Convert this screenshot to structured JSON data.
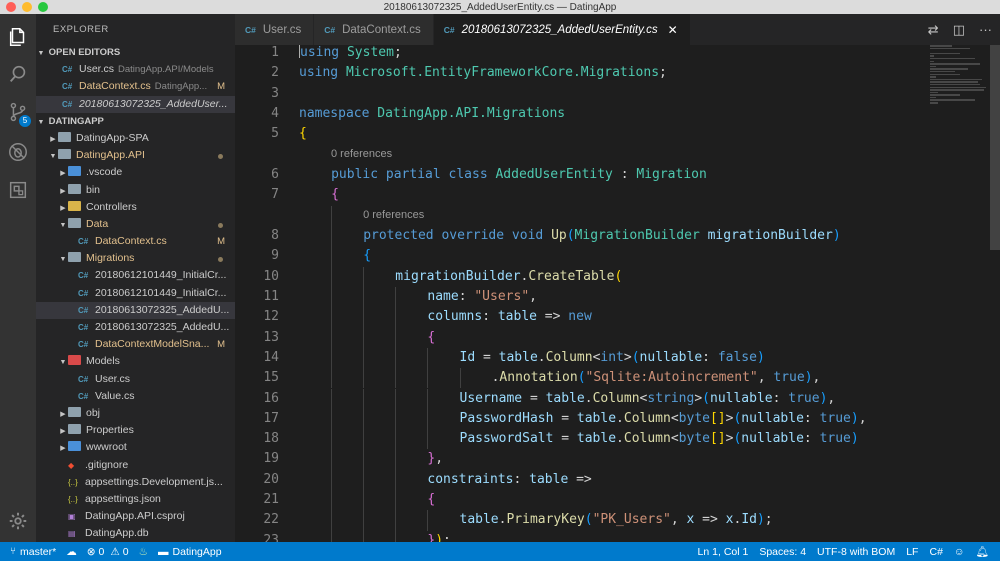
{
  "window": {
    "title": "20180613072325_AddedUserEntity.cs — DatingApp",
    "traffic_lights": [
      "#ff5f57",
      "#febc2e",
      "#28c840"
    ]
  },
  "activity_bar": {
    "items": [
      {
        "icon": "files-icon"
      },
      {
        "icon": "search-icon"
      },
      {
        "icon": "source-control-icon",
        "badge": "5"
      },
      {
        "icon": "debug-icon"
      },
      {
        "icon": "extensions-icon"
      }
    ],
    "settings_icon": "gear-icon"
  },
  "explorer": {
    "title": "EXPLORER",
    "open_editors": {
      "label": "OPEN EDITORS",
      "items": [
        {
          "name": "User.cs",
          "hint": "DatingApp.API/Models",
          "mark": ""
        },
        {
          "name": "DataContext.cs",
          "hint": "DatingApp...",
          "mark": "M"
        },
        {
          "name": "20180613072325_AddedUser...",
          "hint": "",
          "mark": ""
        }
      ]
    },
    "project": {
      "label": "DATINGAPP",
      "tree": [
        {
          "name": "DatingApp-SPA",
          "kind": "folder",
          "depth": 0,
          "open": false
        },
        {
          "name": "DatingApp.API",
          "kind": "folder",
          "depth": 0,
          "open": true,
          "dot": true,
          "yellow": true
        },
        {
          "name": ".vscode",
          "kind": "folder",
          "depth": 1,
          "open": false
        },
        {
          "name": "bin",
          "kind": "folder",
          "depth": 1,
          "open": false
        },
        {
          "name": "Controllers",
          "kind": "folder",
          "depth": 1,
          "open": false
        },
        {
          "name": "Data",
          "kind": "folder",
          "depth": 1,
          "open": true,
          "dot": true,
          "yellow": true
        },
        {
          "name": "DataContext.cs",
          "kind": "cs",
          "depth": 2,
          "mark": "M",
          "yellow": true
        },
        {
          "name": "Migrations",
          "kind": "folder",
          "depth": 1,
          "open": true,
          "dot": true,
          "yellow": true
        },
        {
          "name": "20180612101449_InitialCr...",
          "kind": "cs",
          "depth": 2
        },
        {
          "name": "20180612101449_InitialCr...",
          "kind": "cs",
          "depth": 2
        },
        {
          "name": "20180613072325_AddedU...",
          "kind": "cs",
          "depth": 2,
          "selected": true
        },
        {
          "name": "20180613072325_AddedU...",
          "kind": "cs",
          "depth": 2
        },
        {
          "name": "DataContextModelSna...",
          "kind": "cs",
          "depth": 2,
          "mark": "M",
          "yellow": true
        },
        {
          "name": "Models",
          "kind": "folder",
          "depth": 1,
          "open": true
        },
        {
          "name": "User.cs",
          "kind": "cs",
          "depth": 2
        },
        {
          "name": "Value.cs",
          "kind": "cs",
          "depth": 2
        },
        {
          "name": "obj",
          "kind": "folder",
          "depth": 1,
          "open": false
        },
        {
          "name": "Properties",
          "kind": "folder",
          "depth": 1,
          "open": false
        },
        {
          "name": "wwwroot",
          "kind": "folder",
          "depth": 1,
          "open": false
        },
        {
          "name": ".gitignore",
          "kind": "git",
          "depth": 1
        },
        {
          "name": "appsettings.Development.js...",
          "kind": "json",
          "depth": 1
        },
        {
          "name": "appsettings.json",
          "kind": "json",
          "depth": 1
        },
        {
          "name": "DatingApp.API.csproj",
          "kind": "proj",
          "depth": 1
        },
        {
          "name": "DatingApp.db",
          "kind": "db",
          "depth": 1
        }
      ]
    }
  },
  "tabs": [
    {
      "label": "User.cs",
      "active": false
    },
    {
      "label": "DataContext.cs",
      "active": false
    },
    {
      "label": "20180613072325_AddedUserEntity.cs",
      "active": true
    }
  ],
  "tab_icon_text": "C#",
  "editor": {
    "references_label": "0 references",
    "lines": [
      {
        "n": "1",
        "indent": 0,
        "tokens": [
          [
            "kw",
            "using"
          ],
          [
            "tx",
            " "
          ],
          [
            "ty",
            "System"
          ],
          [
            "tx",
            ";"
          ]
        ],
        "caret": true
      },
      {
        "n": "2",
        "indent": 0,
        "tokens": [
          [
            "kw",
            "using"
          ],
          [
            "tx",
            " "
          ],
          [
            "ty",
            "Microsoft.EntityFrameworkCore.Migrations"
          ],
          [
            "tx",
            ";"
          ]
        ]
      },
      {
        "n": "3",
        "indent": 0,
        "tokens": []
      },
      {
        "n": "4",
        "indent": 0,
        "tokens": [
          [
            "kw",
            "namespace"
          ],
          [
            "tx",
            " "
          ],
          [
            "ty",
            "DatingApp.API.Migrations"
          ]
        ]
      },
      {
        "n": "5",
        "indent": 0,
        "tokens": [
          [
            "b1",
            "{"
          ]
        ]
      },
      {
        "n": "6",
        "indent": 1,
        "lens": true,
        "tokens": [
          [
            "kw",
            "public"
          ],
          [
            "tx",
            " "
          ],
          [
            "kw",
            "partial"
          ],
          [
            "tx",
            " "
          ],
          [
            "kw",
            "class"
          ],
          [
            "tx",
            " "
          ],
          [
            "ty",
            "AddedUserEntity"
          ],
          [
            "tx",
            " : "
          ],
          [
            "ty",
            "Migration"
          ]
        ]
      },
      {
        "n": "7",
        "indent": 1,
        "tokens": [
          [
            "b2",
            "{"
          ]
        ]
      },
      {
        "n": "8",
        "indent": 2,
        "lens": true,
        "tokens": [
          [
            "kw",
            "protected"
          ],
          [
            "tx",
            " "
          ],
          [
            "kw",
            "override"
          ],
          [
            "tx",
            " "
          ],
          [
            "kw",
            "void"
          ],
          [
            "tx",
            " "
          ],
          [
            "fn",
            "Up"
          ],
          [
            "b3",
            "("
          ],
          [
            "ty",
            "MigrationBuilder"
          ],
          [
            "tx",
            " "
          ],
          [
            "pr",
            "migrationBuilder"
          ],
          [
            "b3",
            ")"
          ]
        ]
      },
      {
        "n": "9",
        "indent": 2,
        "tokens": [
          [
            "b3",
            "{"
          ]
        ]
      },
      {
        "n": "10",
        "indent": 3,
        "tokens": [
          [
            "pr",
            "migrationBuilder"
          ],
          [
            "tx",
            "."
          ],
          [
            "fn",
            "CreateTable"
          ],
          [
            "b1",
            "("
          ]
        ]
      },
      {
        "n": "11",
        "indent": 4,
        "tokens": [
          [
            "pr",
            "name"
          ],
          [
            "tx",
            ": "
          ],
          [
            "st",
            "\"Users\""
          ],
          [
            "tx",
            ","
          ]
        ]
      },
      {
        "n": "12",
        "indent": 4,
        "tokens": [
          [
            "pr",
            "columns"
          ],
          [
            "tx",
            ": "
          ],
          [
            "pr",
            "table"
          ],
          [
            "tx",
            " => "
          ],
          [
            "kw",
            "new"
          ]
        ]
      },
      {
        "n": "13",
        "indent": 4,
        "tokens": [
          [
            "b2",
            "{"
          ]
        ]
      },
      {
        "n": "14",
        "indent": 5,
        "tokens": [
          [
            "pr",
            "Id"
          ],
          [
            "tx",
            " = "
          ],
          [
            "pr",
            "table"
          ],
          [
            "tx",
            "."
          ],
          [
            "fn",
            "Column"
          ],
          [
            "tx",
            "<"
          ],
          [
            "kw",
            "int"
          ],
          [
            "tx",
            ">"
          ],
          [
            "b3",
            "("
          ],
          [
            "pr",
            "nullable"
          ],
          [
            "tx",
            ": "
          ],
          [
            "kw",
            "false"
          ],
          [
            "b3",
            ")"
          ]
        ]
      },
      {
        "n": "15",
        "indent": 6,
        "tokens": [
          [
            "tx",
            "."
          ],
          [
            "fn",
            "Annotation"
          ],
          [
            "b3",
            "("
          ],
          [
            "st",
            "\"Sqlite:Autoincrement\""
          ],
          [
            "tx",
            ", "
          ],
          [
            "kw",
            "true"
          ],
          [
            "b3",
            ")"
          ],
          [
            "tx",
            ","
          ]
        ]
      },
      {
        "n": "16",
        "indent": 5,
        "tokens": [
          [
            "pr",
            "Username"
          ],
          [
            "tx",
            " = "
          ],
          [
            "pr",
            "table"
          ],
          [
            "tx",
            "."
          ],
          [
            "fn",
            "Column"
          ],
          [
            "tx",
            "<"
          ],
          [
            "kw",
            "string"
          ],
          [
            "tx",
            ">"
          ],
          [
            "b3",
            "("
          ],
          [
            "pr",
            "nullable"
          ],
          [
            "tx",
            ": "
          ],
          [
            "kw",
            "true"
          ],
          [
            "b3",
            ")"
          ],
          [
            "tx",
            ","
          ]
        ]
      },
      {
        "n": "17",
        "indent": 5,
        "tokens": [
          [
            "pr",
            "PasswordHash"
          ],
          [
            "tx",
            " = "
          ],
          [
            "pr",
            "table"
          ],
          [
            "tx",
            "."
          ],
          [
            "fn",
            "Column"
          ],
          [
            "tx",
            "<"
          ],
          [
            "kw",
            "byte"
          ],
          [
            "b1",
            "[]"
          ],
          [
            "tx",
            ">"
          ],
          [
            "b3",
            "("
          ],
          [
            "pr",
            "nullable"
          ],
          [
            "tx",
            ": "
          ],
          [
            "kw",
            "true"
          ],
          [
            "b3",
            ")"
          ],
          [
            "tx",
            ","
          ]
        ]
      },
      {
        "n": "18",
        "indent": 5,
        "tokens": [
          [
            "pr",
            "PasswordSalt"
          ],
          [
            "tx",
            " = "
          ],
          [
            "pr",
            "table"
          ],
          [
            "tx",
            "."
          ],
          [
            "fn",
            "Column"
          ],
          [
            "tx",
            "<"
          ],
          [
            "kw",
            "byte"
          ],
          [
            "b1",
            "[]"
          ],
          [
            "tx",
            ">"
          ],
          [
            "b3",
            "("
          ],
          [
            "pr",
            "nullable"
          ],
          [
            "tx",
            ": "
          ],
          [
            "kw",
            "true"
          ],
          [
            "b3",
            ")"
          ]
        ]
      },
      {
        "n": "19",
        "indent": 4,
        "tokens": [
          [
            "b2",
            "}"
          ],
          [
            "tx",
            ","
          ]
        ]
      },
      {
        "n": "20",
        "indent": 4,
        "tokens": [
          [
            "pr",
            "constraints"
          ],
          [
            "tx",
            ": "
          ],
          [
            "pr",
            "table"
          ],
          [
            "tx",
            " =>"
          ]
        ]
      },
      {
        "n": "21",
        "indent": 4,
        "tokens": [
          [
            "b2",
            "{"
          ]
        ]
      },
      {
        "n": "22",
        "indent": 5,
        "tokens": [
          [
            "pr",
            "table"
          ],
          [
            "tx",
            "."
          ],
          [
            "fn",
            "PrimaryKey"
          ],
          [
            "b3",
            "("
          ],
          [
            "st",
            "\"PK_Users\""
          ],
          [
            "tx",
            ", "
          ],
          [
            "pr",
            "x"
          ],
          [
            "tx",
            " => "
          ],
          [
            "pr",
            "x"
          ],
          [
            "tx",
            "."
          ],
          [
            "pr",
            "Id"
          ],
          [
            "b3",
            ")"
          ],
          [
            "tx",
            ";"
          ]
        ]
      },
      {
        "n": "23",
        "indent": 4,
        "tokens": [
          [
            "b2",
            "}"
          ],
          [
            "b1",
            ")"
          ],
          [
            "tx",
            ";"
          ]
        ]
      }
    ]
  },
  "statusbar": {
    "branch": "master*",
    "errors": "0",
    "warnings": "0",
    "project": "DatingApp",
    "position": "Ln 1, Col 1",
    "spaces": "Spaces: 4",
    "encoding": "UTF-8 with BOM",
    "eol": "LF",
    "language": "C#"
  },
  "colors": {
    "accent": "#007acc",
    "modified": "#e2c08d",
    "csharp_icon": "#519aba"
  }
}
